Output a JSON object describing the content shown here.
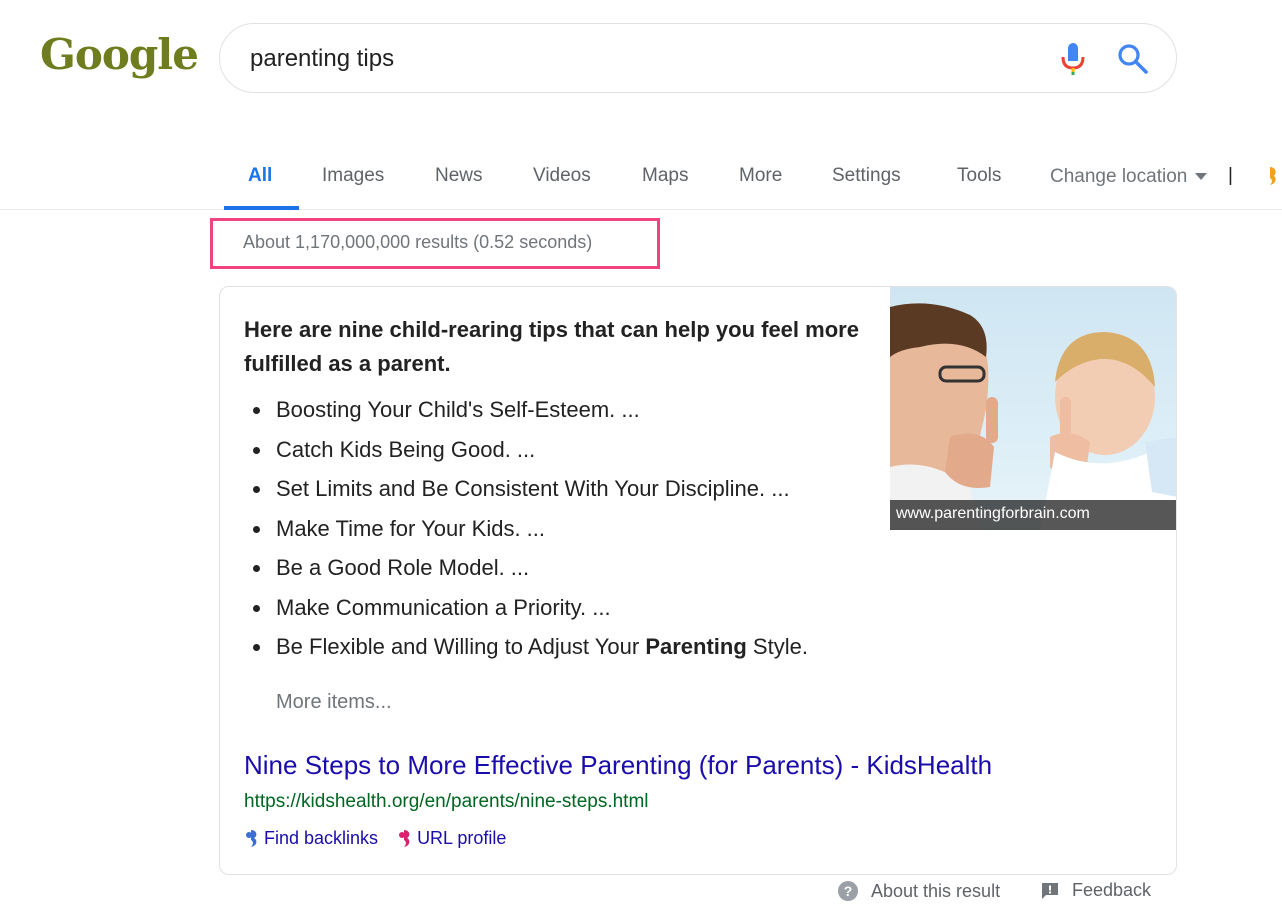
{
  "header": {
    "logo_text": "Google",
    "search": {
      "value": "parenting tips"
    },
    "icons": [
      "microphone-icon",
      "search-icon"
    ]
  },
  "tabs": [
    {
      "label": "All",
      "active": true
    },
    {
      "label": "Images"
    },
    {
      "label": "News"
    },
    {
      "label": "Videos"
    },
    {
      "label": "Maps"
    },
    {
      "label": "More"
    },
    {
      "label": "Settings"
    },
    {
      "label": "Tools"
    }
  ],
  "change_location": "Change location",
  "separator": "|",
  "stats": "About 1,170,000,000 results (0.52 seconds)",
  "snippet": {
    "heading": "Here are nine child-rearing tips that can help you feel more fulfilled as a parent.",
    "items": [
      {
        "text": "Boosting Your Child's Self-Esteem. ..."
      },
      {
        "text": "Catch Kids Being Good. ..."
      },
      {
        "text": "Set Limits and Be Consistent With Your Discipline. ..."
      },
      {
        "text": "Make Time for Your Kids. ..."
      },
      {
        "text": "Be a Good Role Model. ..."
      },
      {
        "text": "Make Communication a Priority. ..."
      },
      {
        "pre": "Be Flexible and Willing to Adjust Your ",
        "bold": "Parenting",
        "post": " Style."
      }
    ],
    "more_items": "More items...",
    "image_source": "www.parentingforbrain.com",
    "result_title": "Nine Steps to More Effective Parenting (for Parents) - KidsHealth",
    "result_url": "https://kidshealth.org/en/parents/nine-steps.html",
    "tool_links": {
      "find_backlinks": "Find backlinks",
      "url_profile": "URL profile"
    }
  },
  "footer": {
    "about_result": "About this result",
    "feedback": "Feedback"
  },
  "colors": {
    "accent": "#1a73e8",
    "link": "#1a0dab",
    "url": "#006621",
    "highlight": "#f0457c",
    "logo": "#6f7d1f"
  }
}
